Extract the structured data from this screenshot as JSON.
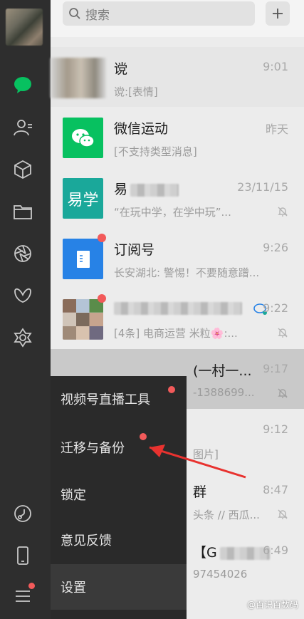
{
  "search": {
    "placeholder": "搜索"
  },
  "sidebar": {
    "icons": [
      "chat-icon",
      "contacts-icon",
      "cube-icon",
      "folder-icon",
      "aperture-icon",
      "butterfly-icon",
      "mini-program-icon",
      "music-icon",
      "phone-icon",
      "menu-icon"
    ]
  },
  "chats": [
    {
      "name": "谠",
      "preview": "谠:[表情]",
      "time": "9:01",
      "muted": false,
      "badge": false
    },
    {
      "name": "微信运动",
      "preview": "[不支持类型消息]",
      "time": "昨天",
      "muted": false,
      "badge": false
    },
    {
      "name": "易",
      "preview": "“在玩中学，在学中玩”...",
      "time": "23/11/15",
      "muted": true,
      "badge": false
    },
    {
      "name": "订阅号",
      "preview": "长安湖北: 警惕！不要随意蹭...",
      "time": "9:26",
      "muted": false,
      "badge": true
    },
    {
      "name": "",
      "preview": "[4条] 电商运营 米粒🌸:...",
      "time": "9:22",
      "muted": true,
      "badge": true
    },
    {
      "name": "(一村一...",
      "preview": "-1388699...",
      "time": "9:17",
      "muted": true,
      "badge": false
    },
    {
      "name": "",
      "preview": "图片]",
      "time": "9:12",
      "muted": false,
      "badge": false
    },
    {
      "name": "群",
      "preview": "头条 // 西瓜...",
      "time": "8:47",
      "muted": true,
      "badge": false
    },
    {
      "name": "【G",
      "preview": "97454026",
      "time": "6:49",
      "muted": false,
      "badge": false
    }
  ],
  "popup_menu": {
    "items": [
      {
        "label": "视频号直播工具",
        "dot": true
      },
      {
        "label": "迁移与备份",
        "dot": true
      },
      {
        "label": "锁定",
        "dot": false
      },
      {
        "label": "意见反馈",
        "dot": false
      },
      {
        "label": "设置",
        "dot": false
      }
    ]
  },
  "watermark": "@百识百数码",
  "colors": {
    "sidebar_bg": "#2e2e2e",
    "wechat_green": "#07c160",
    "accent_red": "#f25a5a",
    "popup_bg": "#2a2a2a",
    "subscription_blue": "#2782e6",
    "yixue_teal": "#1aa89a"
  }
}
